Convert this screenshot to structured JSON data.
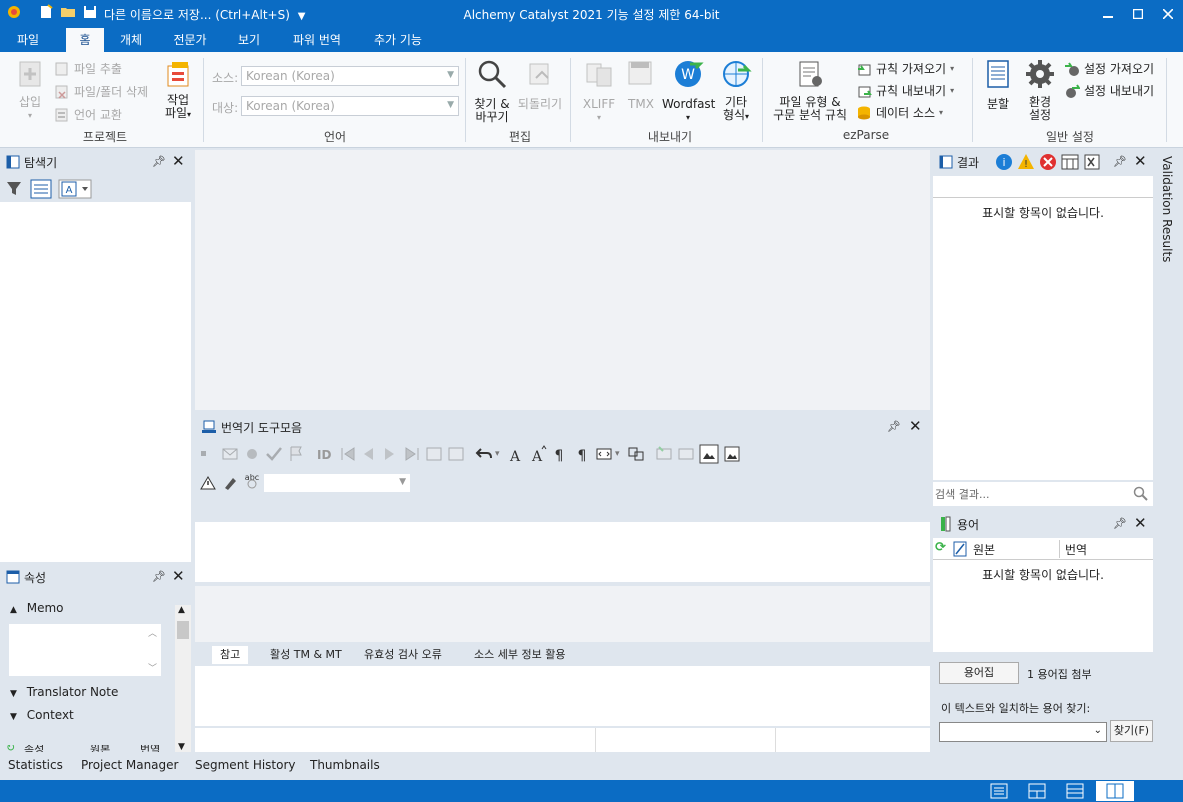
{
  "titlebar": {
    "save_as": "다른 이름으로 저장... (Ctrl+Alt+S)",
    "title": "Alchemy Catalyst 2021 기능 설정 제한 64-bit"
  },
  "ribbon_tabs": [
    "파일",
    "홈",
    "개체",
    "전문가",
    "보기",
    "파워 번역",
    "추가 기능"
  ],
  "ribbon": {
    "project": {
      "insert": "삽입",
      "extract_file": "파일 추출",
      "delete_file_folder": "파일/폴더 삭제",
      "swap_language": "언어 교환",
      "task_file_1": "작업",
      "task_file_2": "파일",
      "label": "프로젝트"
    },
    "language": {
      "source_label": "소스:",
      "source_value": "Korean (Korea)",
      "target_label": "대상:",
      "target_value": "Korean (Korea)",
      "label": "언어"
    },
    "edit": {
      "find_replace_1": "찾기 &",
      "find_replace_2": "바꾸기",
      "revert": "되돌리기",
      "label": "편집"
    },
    "export": {
      "xliff": "XLIFF",
      "tmx": "TMX",
      "wordfast": "Wordfast",
      "other_1": "기타",
      "other_2": "형식",
      "label": "내보내기"
    },
    "ezparse": {
      "file_type_1": "파일 유형 &",
      "file_type_2": "구문 분석 규칙",
      "import_rules": "규칙 가져오기",
      "export_rules": "규칙 내보내기",
      "data_source": "데이터 소스",
      "label": "ezParse"
    },
    "general": {
      "split": "분할",
      "env_1": "환경",
      "env_2": "설정",
      "import_settings": "설정 가져오기",
      "export_settings": "설정 내보내기",
      "label": "일반 설정"
    }
  },
  "explorer": {
    "title": "탐색기"
  },
  "properties": {
    "title": "속성",
    "memo": "Memo",
    "translator_note": "Translator Note",
    "context": "Context",
    "cut_row": [
      "속성",
      "원본",
      "번역"
    ]
  },
  "translator_toolbar": {
    "title": "번역기 도구모음",
    "id_label": "ID"
  },
  "lower_tabs": [
    "참고",
    "활성 TM & MT",
    "유효성 검사 오류",
    "소스 세부 정보 활용"
  ],
  "results": {
    "title": "결과",
    "empty": "표시할 항목이 없습니다.",
    "search_placeholder": "검색 결과..."
  },
  "validation_results": "Validation Results",
  "terms": {
    "title": "용어",
    "col_source": "원본",
    "col_translation": "번역",
    "empty": "표시할 항목이 없습니다.",
    "glossary_button": "용어집",
    "glossary_count": "1 용어집 첨부",
    "find_label": "이 텍스트와 일치하는 용어 찾기:",
    "find_button": "찾기(F)"
  },
  "bottom_tabs": [
    "Statistics",
    "Project Manager",
    "Segment History",
    "Thumbnails"
  ],
  "colors": {
    "accent": "#0b6cc4",
    "panel_bg": "#dfe6ee"
  }
}
